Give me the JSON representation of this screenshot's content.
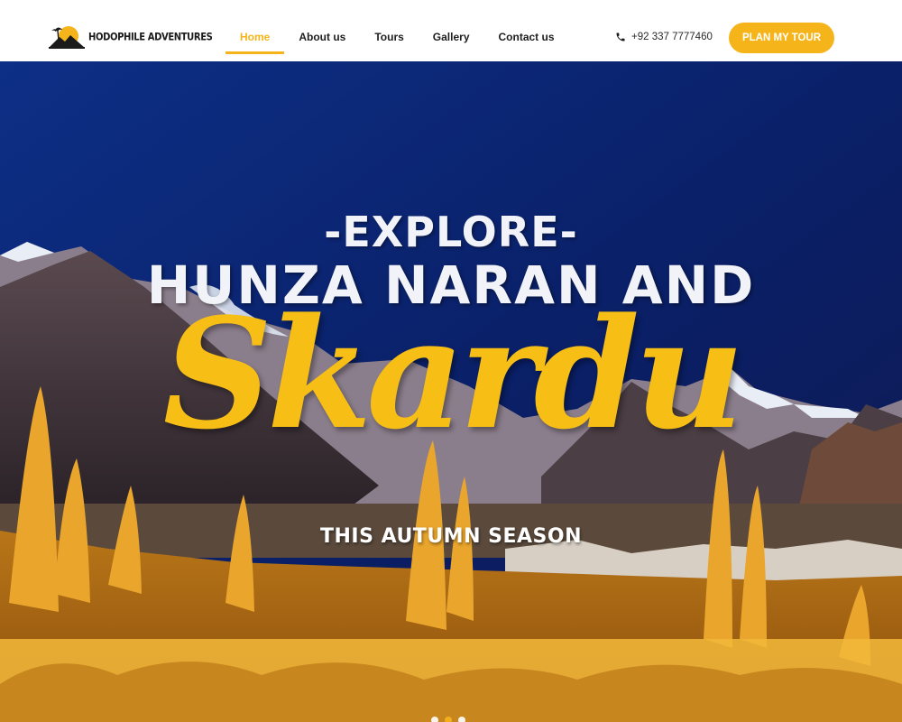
{
  "brand": {
    "name": "HODOPHILE ADVENTURES",
    "accent_color": "#f6b41b"
  },
  "nav": {
    "items": [
      {
        "label": "Home",
        "active": true
      },
      {
        "label": "About us",
        "active": false
      },
      {
        "label": "Tours",
        "active": false
      },
      {
        "label": "Gallery",
        "active": false
      },
      {
        "label": "Contact us",
        "active": false
      }
    ]
  },
  "contact": {
    "phone": "+92 337 7777460",
    "icon": "phone-icon"
  },
  "cta": {
    "label": "PLAN MY TOUR"
  },
  "hero": {
    "eyebrow": "-EXPLORE-",
    "headline": "HUNZA NARAN AND",
    "highlight": "Skardu",
    "tagline": "THIS AUTUMN SEASON",
    "slides": {
      "count": 3,
      "active": 1
    }
  }
}
